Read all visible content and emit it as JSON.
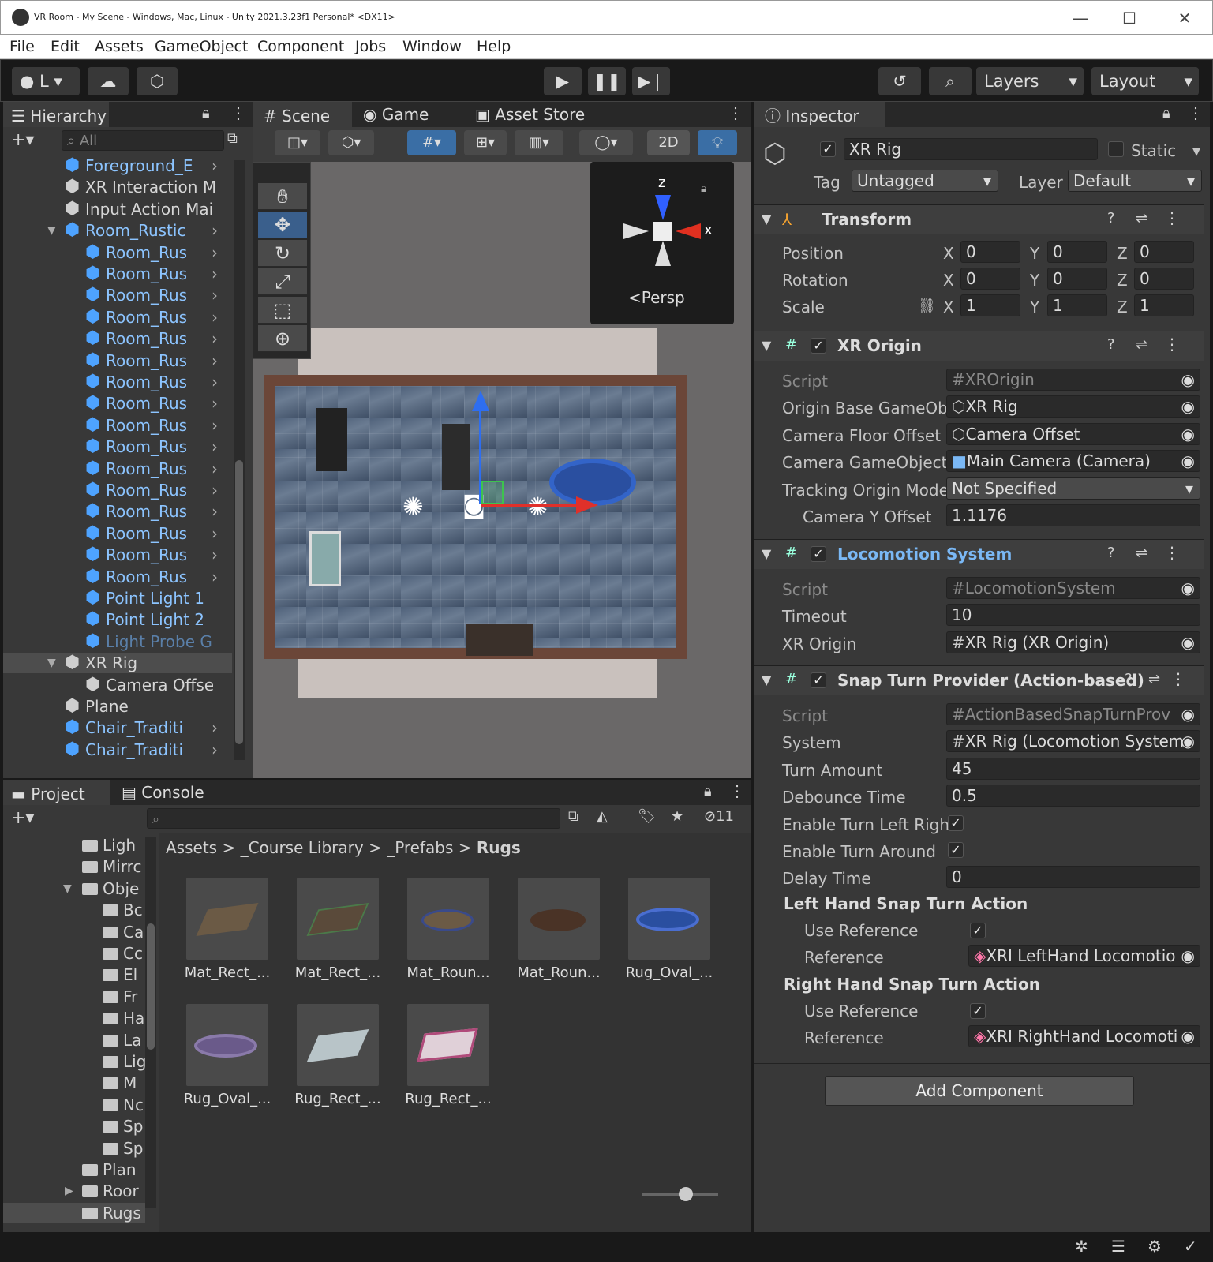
{
  "window": {
    "title": "VR Room - My Scene - Windows, Mac, Linux - Unity 2021.3.23f1 Personal* <DX11>",
    "minimize": "—",
    "maximize": "☐",
    "close": "✕"
  },
  "menu": [
    "File",
    "Edit",
    "Assets",
    "GameObject",
    "Component",
    "Jobs",
    "Window",
    "Help"
  ],
  "toolbar": {
    "account": "L",
    "layers": "Layers",
    "layout": "Layout"
  },
  "hierarchy": {
    "tab": "Hierarchy",
    "search_placeholder": "All",
    "items": [
      {
        "label": "Foreground_E",
        "indent": 1,
        "blue": true,
        "arrow": true
      },
      {
        "label": "XR Interaction M",
        "indent": 1,
        "blue": false,
        "arrow": false
      },
      {
        "label": "Input Action Mai",
        "indent": 1,
        "blue": false,
        "arrow": false
      },
      {
        "label": "Room_Rustic",
        "indent": 1,
        "blue": true,
        "arrow": true,
        "expanded": true
      },
      {
        "label": "Room_Rus",
        "indent": 2,
        "blue": true,
        "arrow": true
      },
      {
        "label": "Room_Rus",
        "indent": 2,
        "blue": true,
        "arrow": true
      },
      {
        "label": "Room_Rus",
        "indent": 2,
        "blue": true,
        "arrow": true
      },
      {
        "label": "Room_Rus",
        "indent": 2,
        "blue": true,
        "arrow": true
      },
      {
        "label": "Room_Rus",
        "indent": 2,
        "blue": true,
        "arrow": true
      },
      {
        "label": "Room_Rus",
        "indent": 2,
        "blue": true,
        "arrow": true
      },
      {
        "label": "Room_Rus",
        "indent": 2,
        "blue": true,
        "arrow": true
      },
      {
        "label": "Room_Rus",
        "indent": 2,
        "blue": true,
        "arrow": true
      },
      {
        "label": "Room_Rus",
        "indent": 2,
        "blue": true,
        "arrow": true
      },
      {
        "label": "Room_Rus",
        "indent": 2,
        "blue": true,
        "arrow": true
      },
      {
        "label": "Room_Rus",
        "indent": 2,
        "blue": true,
        "arrow": true
      },
      {
        "label": "Room_Rus",
        "indent": 2,
        "blue": true,
        "arrow": true
      },
      {
        "label": "Room_Rus",
        "indent": 2,
        "blue": true,
        "arrow": true
      },
      {
        "label": "Room_Rus",
        "indent": 2,
        "blue": true,
        "arrow": true
      },
      {
        "label": "Room_Rus",
        "indent": 2,
        "blue": true,
        "arrow": true
      },
      {
        "label": "Room_Rus",
        "indent": 2,
        "blue": true,
        "arrow": true
      },
      {
        "label": "Point Light 1",
        "indent": 2,
        "blue": true,
        "arrow": false
      },
      {
        "label": "Point Light 2",
        "indent": 2,
        "blue": true,
        "arrow": false
      },
      {
        "label": "Light Probe G",
        "indent": 2,
        "blue": true,
        "arrow": false,
        "faded": true
      },
      {
        "label": "XR Rig",
        "indent": 1,
        "blue": false,
        "arrow": false,
        "expanded": true,
        "selected": true
      },
      {
        "label": "Camera Offse",
        "indent": 2,
        "blue": false,
        "arrow": false
      },
      {
        "label": "Plane",
        "indent": 1,
        "blue": false,
        "arrow": false
      },
      {
        "label": "Chair_Traditi",
        "indent": 1,
        "blue": true,
        "arrow": true
      },
      {
        "label": "Chair_Traditi",
        "indent": 1,
        "blue": true,
        "arrow": true
      }
    ]
  },
  "scene": {
    "tabs": [
      "Scene",
      "Game",
      "Asset Store"
    ],
    "mode_2d": "2D",
    "gizmo_label": "Persp",
    "axis_x": "x",
    "axis_z": "z"
  },
  "project": {
    "tabs": [
      "Project",
      "Console"
    ],
    "hidden_count": "11",
    "breadcrumb": [
      "Assets",
      "_Course Library",
      "_Prefabs",
      "Rugs"
    ],
    "tree": [
      "Ligh",
      "Mirrc",
      "Obje",
      "Bc",
      "Ca",
      "Cc",
      "El",
      "Fr",
      "Ha",
      "La",
      "Lig",
      "M",
      "Nc",
      "Sp",
      "Sp",
      "Plan",
      "Roor",
      "Rugs"
    ],
    "assets": [
      {
        "label": "Mat_Rect_...",
        "kind": "rect-brown"
      },
      {
        "label": "Mat_Rect_...",
        "kind": "rect-green"
      },
      {
        "label": "Mat_Roun...",
        "kind": "round-blue"
      },
      {
        "label": "Mat_Roun...",
        "kind": "round-brown"
      },
      {
        "label": "Rug_Oval_...",
        "kind": "oval-blue"
      },
      {
        "label": "Rug_Oval_...",
        "kind": "oval-purple"
      },
      {
        "label": "Rug_Rect_...",
        "kind": "rect-light"
      },
      {
        "label": "Rug_Rect_...",
        "kind": "rect-pink"
      }
    ]
  },
  "inspector": {
    "tab": "Inspector",
    "object_name": "XR Rig",
    "static_label": "Static",
    "tag_label": "Tag",
    "tag_value": "Untagged",
    "layer_label": "Layer",
    "layer_value": "Default",
    "transform": {
      "title": "Transform",
      "position_label": "Position",
      "rotation_label": "Rotation",
      "scale_label": "Scale",
      "position": [
        "0",
        "0",
        "0"
      ],
      "rotation": [
        "0",
        "0",
        "0"
      ],
      "scale": [
        "1",
        "1",
        "1"
      ],
      "axes": [
        "X",
        "Y",
        "Z"
      ]
    },
    "xr_origin": {
      "title": "XR Origin",
      "fields": [
        {
          "label": "Script",
          "value": "XROrigin",
          "dim": true
        },
        {
          "label": "Origin Base GameObj",
          "value": "XR Rig"
        },
        {
          "label": "Camera Floor Offset C",
          "value": "Camera Offset"
        },
        {
          "label": "Camera GameObject",
          "value": "Main Camera (Camera)"
        },
        {
          "label": "Tracking Origin Mode",
          "value": "Not Specified"
        },
        {
          "label": "Camera Y Offset",
          "value": "1.1176"
        }
      ]
    },
    "locomotion": {
      "title": "Locomotion System",
      "fields": [
        {
          "label": "Script",
          "value": "LocomotionSystem"
        },
        {
          "label": "Timeout",
          "value": "10"
        },
        {
          "label": "XR Origin",
          "value": "XR Rig (XR Origin)"
        }
      ]
    },
    "snap": {
      "title": "Snap Turn Provider (Action-based)",
      "fields": [
        {
          "label": "Script",
          "value": "ActionBasedSnapTurnProv"
        },
        {
          "label": "System",
          "value": "XR Rig (Locomotion System"
        },
        {
          "label": "Turn Amount",
          "value": "45"
        },
        {
          "label": "Debounce Time",
          "value": "0.5"
        },
        {
          "label": "Enable Turn Left Right",
          "value": "✓"
        },
        {
          "label": "Enable Turn Around",
          "value": "✓"
        },
        {
          "label": "Delay Time",
          "value": "0"
        }
      ],
      "left_header": "Left Hand Snap Turn Action",
      "right_header": "Right Hand Snap Turn Action",
      "use_reference": "Use Reference",
      "reference": "Reference",
      "left_ref": "XRI LeftHand Locomotio",
      "right_ref": "XRI RightHand Locomoti"
    },
    "add_component": "Add Component"
  },
  "colors": {
    "accent": "#3a78c2",
    "selected": "#4d4d4d",
    "link": "#7ab8f5"
  }
}
